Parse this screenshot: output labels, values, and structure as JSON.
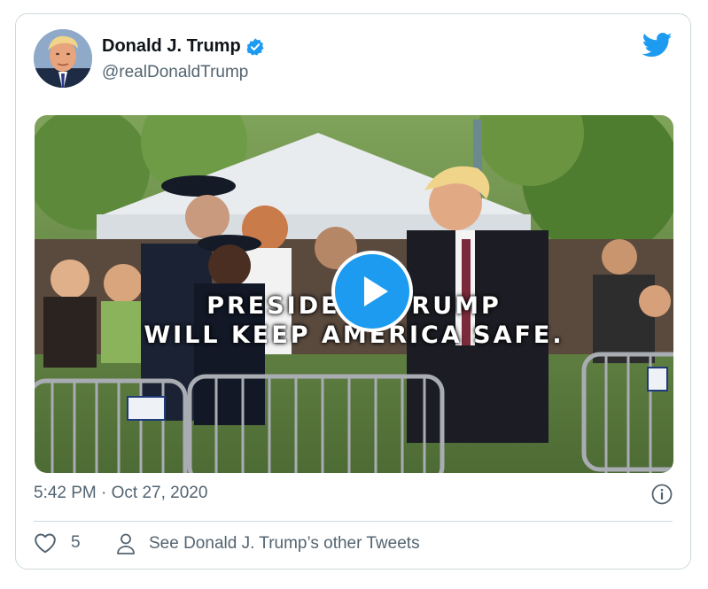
{
  "author": {
    "display_name": "Donald J. Trump",
    "handle": "@realDonaldTrump",
    "verified": true
  },
  "media": {
    "type": "video",
    "caption_line1": "PRESIDENT TRUMP",
    "caption_line2": "WILL KEEP AMERICA SAFE.",
    "play_icon": "play-icon"
  },
  "meta": {
    "timestamp": "5:42 PM · Oct 27, 2020"
  },
  "actions": {
    "like_count": "5",
    "see_other_label": "See Donald J. Trump’s other Tweets"
  },
  "colors": {
    "brand_blue": "#1d9bf0",
    "text_primary": "#0f1419",
    "text_secondary": "#536471",
    "border": "#cfd9de"
  }
}
